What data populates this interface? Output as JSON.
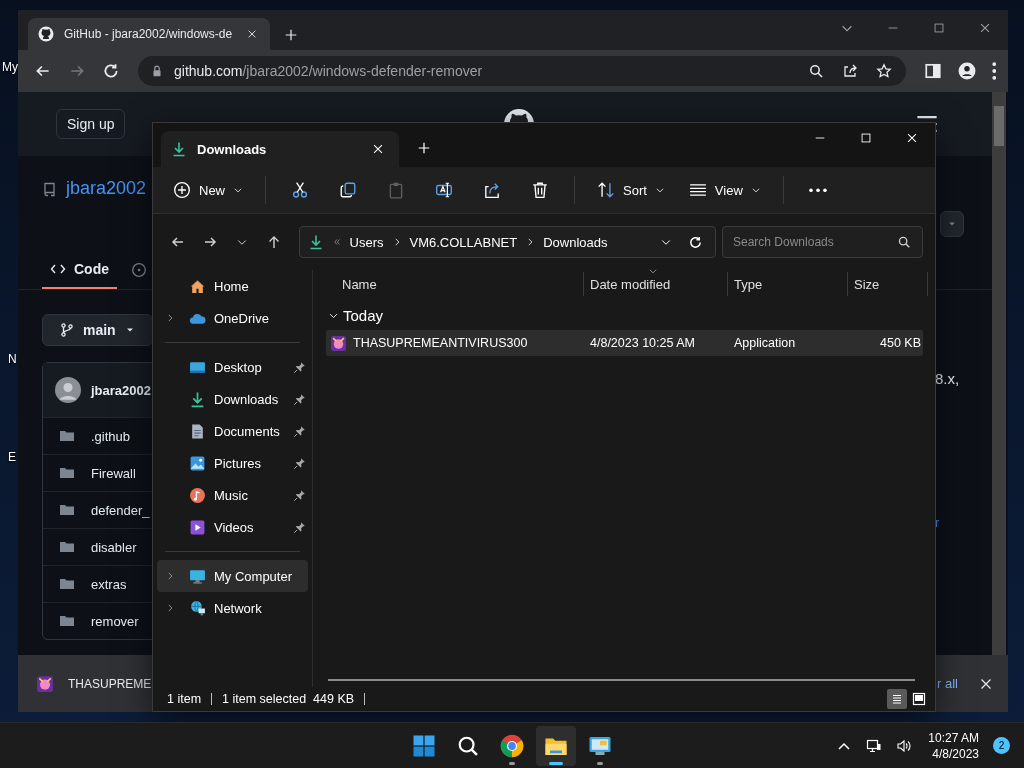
{
  "desktop": {
    "icon_labels": [
      "My",
      "N",
      "E"
    ]
  },
  "browser": {
    "tabs": [
      {
        "title": "GitHub - jbara2002/windows-de",
        "selected": true
      }
    ],
    "forward_enabled": false,
    "url": {
      "host": "github.com",
      "path": "/jbara2002/windows-defender-remover"
    },
    "page": {
      "sign_up": "Sign up",
      "repo_owner": "jbara2002",
      "tabs": [
        {
          "label": "Code",
          "selected": true
        }
      ],
      "branch": "main",
      "commit_author": "jbara2002",
      "files": [
        ".github",
        "Firewall",
        "defender_",
        "disabler",
        "extras",
        "remover"
      ],
      "about_fragment": "8.x,",
      "link_fragment": "r"
    },
    "download_bar": {
      "file": "THASUPREME",
      "show_all": "r all"
    }
  },
  "explorer": {
    "tabs": [
      {
        "title": "Downloads",
        "selected": true
      }
    ],
    "toolbar": [
      {
        "kind": "new",
        "label": "New",
        "disabled": false
      },
      {
        "kind": "cut",
        "disabled": false
      },
      {
        "kind": "copy",
        "disabled": false
      },
      {
        "kind": "paste",
        "disabled": true
      },
      {
        "kind": "rename",
        "disabled": false
      },
      {
        "kind": "share",
        "disabled": false
      },
      {
        "kind": "delete",
        "disabled": false
      },
      {
        "kind": "sort",
        "label": "Sort",
        "disabled": false
      },
      {
        "kind": "view",
        "label": "View",
        "disabled": false
      },
      {
        "kind": "more",
        "disabled": false
      }
    ],
    "breadcrumb": [
      "Users",
      "VM6.COLLABNET",
      "Downloads"
    ],
    "search": {
      "placeholder": "Search Downloads"
    },
    "nav_pane": {
      "groups": [
        {
          "items": [
            {
              "kind": "home",
              "label": "Home",
              "expandable": false,
              "pinned": false,
              "selected": false
            },
            {
              "kind": "cloud",
              "label": "OneDrive",
              "expandable": true,
              "pinned": false,
              "selected": false
            }
          ]
        },
        {
          "items": [
            {
              "kind": "desktop",
              "label": "Desktop",
              "expandable": false,
              "pinned": true,
              "selected": false
            },
            {
              "kind": "downloads",
              "label": "Downloads",
              "expandable": false,
              "pinned": true,
              "selected": false
            },
            {
              "kind": "documents",
              "label": "Documents",
              "expandable": false,
              "pinned": true,
              "selected": false
            },
            {
              "kind": "pictures",
              "label": "Pictures",
              "expandable": false,
              "pinned": true,
              "selected": false
            },
            {
              "kind": "music",
              "label": "Music",
              "expandable": false,
              "pinned": true,
              "selected": false
            },
            {
              "kind": "videos",
              "label": "Videos",
              "expandable": false,
              "pinned": true,
              "selected": false
            }
          ]
        },
        {
          "items": [
            {
              "kind": "computer",
              "label": "My Computer",
              "expandable": true,
              "pinned": false,
              "selected": true
            },
            {
              "kind": "network",
              "label": "Network",
              "expandable": true,
              "pinned": false,
              "selected": false
            }
          ]
        }
      ]
    },
    "columns": [
      {
        "label": "Name",
        "sorted": false
      },
      {
        "label": "Date modified",
        "sorted": true
      },
      {
        "label": "Type",
        "sorted": false
      },
      {
        "label": "Size",
        "sorted": false
      }
    ],
    "groups": [
      {
        "label": "Today",
        "expanded": true,
        "files": [
          {
            "name": "THASUPREMEANTIVIRUS300",
            "date": "4/8/2023 10:25 AM",
            "type": "Application",
            "size": "450 KB",
            "selected": true
          }
        ]
      }
    ],
    "status": {
      "count": "1 item",
      "selection": "1 item selected",
      "selection_size": "449 KB"
    },
    "view_modes": [
      {
        "kind": "details",
        "selected": true
      },
      {
        "kind": "tiles",
        "selected": false
      }
    ]
  },
  "taskbar": {
    "apps": [
      {
        "kind": "start",
        "running": false,
        "active": false
      },
      {
        "kind": "search",
        "running": false,
        "active": false
      },
      {
        "kind": "browser",
        "running": true,
        "active": false
      },
      {
        "kind": "files",
        "running": true,
        "active": true
      },
      {
        "kind": "remote",
        "running": true,
        "active": false
      }
    ],
    "time": "10:27 AM",
    "date": "4/8/2023",
    "notifications": "2"
  }
}
